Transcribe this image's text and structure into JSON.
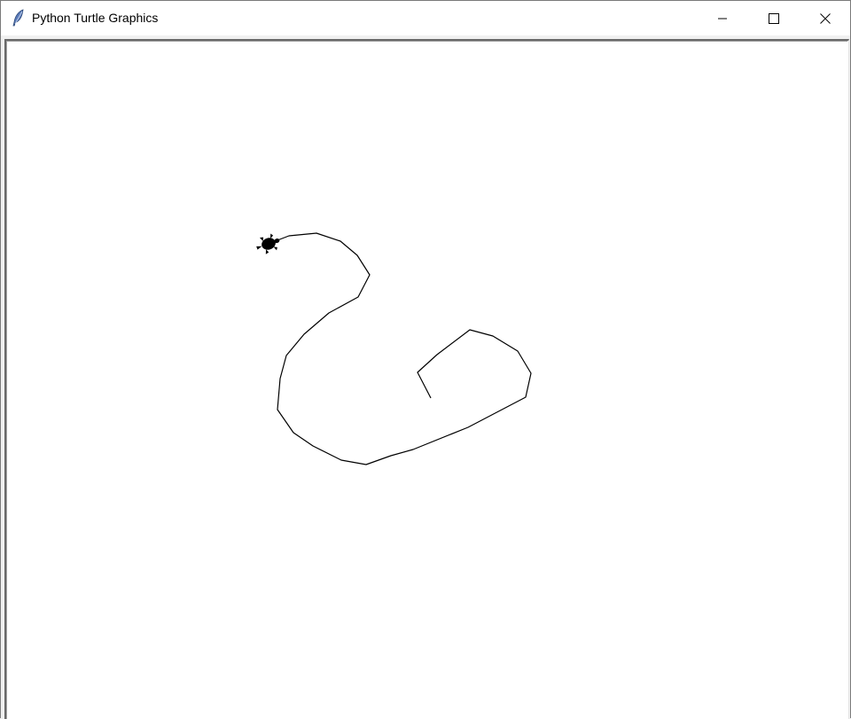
{
  "window": {
    "title": "Python Turtle Graphics",
    "app_icon": "feather-icon",
    "controls": {
      "minimize_icon": "minimize-icon",
      "maximize_icon": "maximize-icon",
      "close_icon": "close-icon"
    }
  },
  "canvas": {
    "background": "#ffffff",
    "pen_color": "#000000",
    "turtle_color": "#000000",
    "turtle_shape": "turtle-icon"
  }
}
